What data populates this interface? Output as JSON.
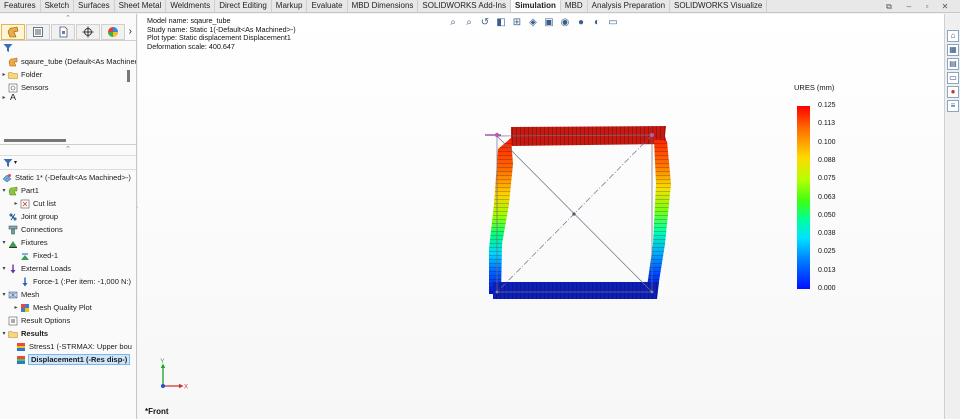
{
  "tabs": [
    "Features",
    "Sketch",
    "Surfaces",
    "Sheet Metal",
    "Weldments",
    "Direct Editing",
    "Markup",
    "Evaluate",
    "MBD Dimensions",
    "SOLIDWORKS Add-Ins",
    "Simulation",
    "MBD",
    "Analysis Preparation",
    "SOLIDWORKS Visualize"
  ],
  "active_tab": "Simulation",
  "window_controls": [
    "restore-icon",
    "minimize-icon",
    "maximize-icon",
    "close-icon"
  ],
  "feature_tree": {
    "root": "sqaure_tube (Default<As Machined",
    "items": [
      "Folder",
      "Sensors"
    ]
  },
  "sim_tree": {
    "study": "Static 1* (-Default<As Machined>-)",
    "part": "Part1",
    "cut_list": "Cut list",
    "joint_group": "Joint group",
    "connections": "Connections",
    "fixtures": "Fixtures",
    "fixed": "Fixed-1",
    "external_loads": "External Loads",
    "force": "Force-1 (:Per item: -1,000 N:)",
    "mesh": "Mesh",
    "mesh_quality": "Mesh Quality Plot",
    "result_options": "Result Options",
    "results": "Results",
    "stress": "Stress1 (-STRMAX: Upper bou",
    "displacement": "Displacement1 (-Res disp-)"
  },
  "plot_info": {
    "model_name": "Model name: sqaure_tube",
    "study_name": "Study name: Static 1(-Default<As Machined>-)",
    "plot_type": "Plot type: Static displacement Displacement1",
    "deformation_scale": "Deformation scale: 400.647"
  },
  "legend": {
    "title": "URES (mm)",
    "ticks": [
      "0.125",
      "0.113",
      "0.100",
      "0.088",
      "0.075",
      "0.063",
      "0.050",
      "0.038",
      "0.025",
      "0.013",
      "0.000"
    ]
  },
  "triad": {
    "y_label": "Y",
    "x_label": "X"
  },
  "view_name": "*Front",
  "hud_icons": [
    "zoom-to-fit-icon",
    "zoom-area-icon",
    "previous-view-icon",
    "section-view-icon",
    "dynamic-annotation-icon",
    "view-orientation-icon",
    "display-style-icon",
    "hide-show-icon",
    "edit-appearance-icon",
    "apply-scene-icon",
    "view-settings-icon"
  ],
  "taskpane_icons": [
    "home-icon",
    "resources-icon",
    "design-library-icon",
    "file-explorer-icon",
    "appearances-icon",
    "custom-properties-icon"
  ],
  "colors": {
    "selected": "#cde6fb",
    "max_disp": "#ff0000",
    "min_disp": "#0010ff"
  }
}
